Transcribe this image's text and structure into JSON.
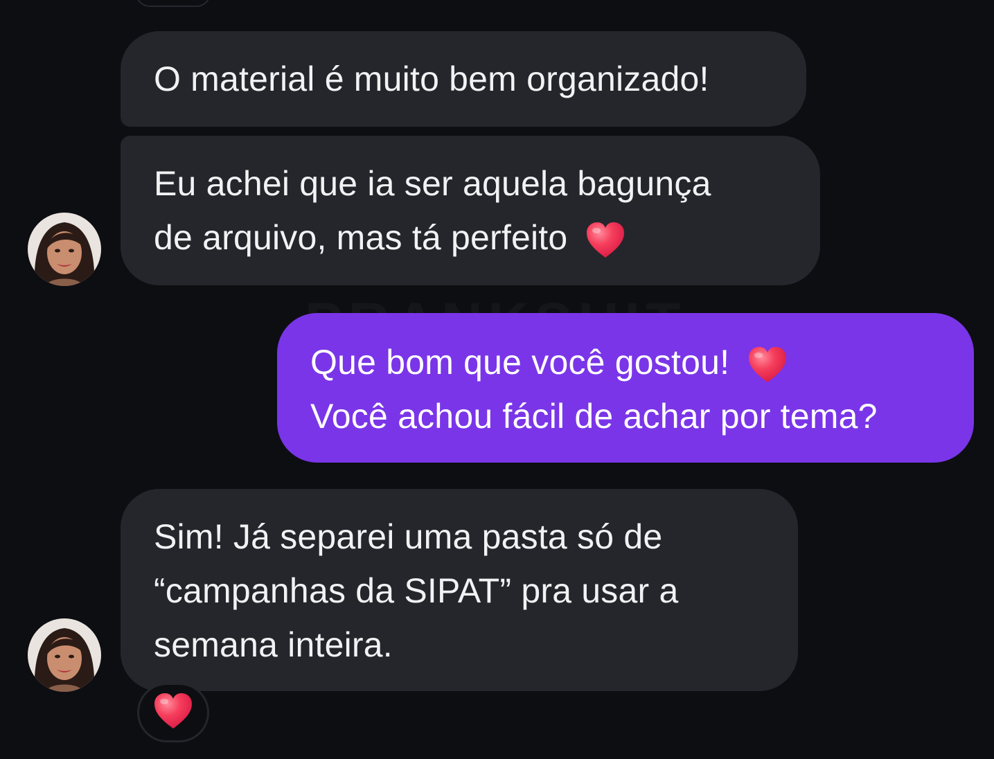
{
  "watermark": "PRANKSHIT",
  "colors": {
    "background": "#0d0e12",
    "incoming_bubble": "#25262b",
    "outgoing_bubble": "#7a35e8",
    "heart": "#f0344f"
  },
  "messages": [
    {
      "sender": "contact",
      "lines": [
        "O material é muito bem organizado!"
      ]
    },
    {
      "sender": "contact",
      "lines": [
        "Eu achei que ia ser aquela bagunça",
        "de arquivo, mas tá perfeito"
      ],
      "emoji": "heart-icon"
    },
    {
      "sender": "me",
      "lines": [
        "Que bom que você gostou!",
        "Você achou fácil de achar por tema?"
      ],
      "emoji": "heart-icon"
    },
    {
      "sender": "contact",
      "lines": [
        "Sim! Já separei uma pasta só de",
        "“campanhas da SIPAT” pra usar a",
        "semana inteira."
      ],
      "reaction": "heart-icon"
    }
  ]
}
